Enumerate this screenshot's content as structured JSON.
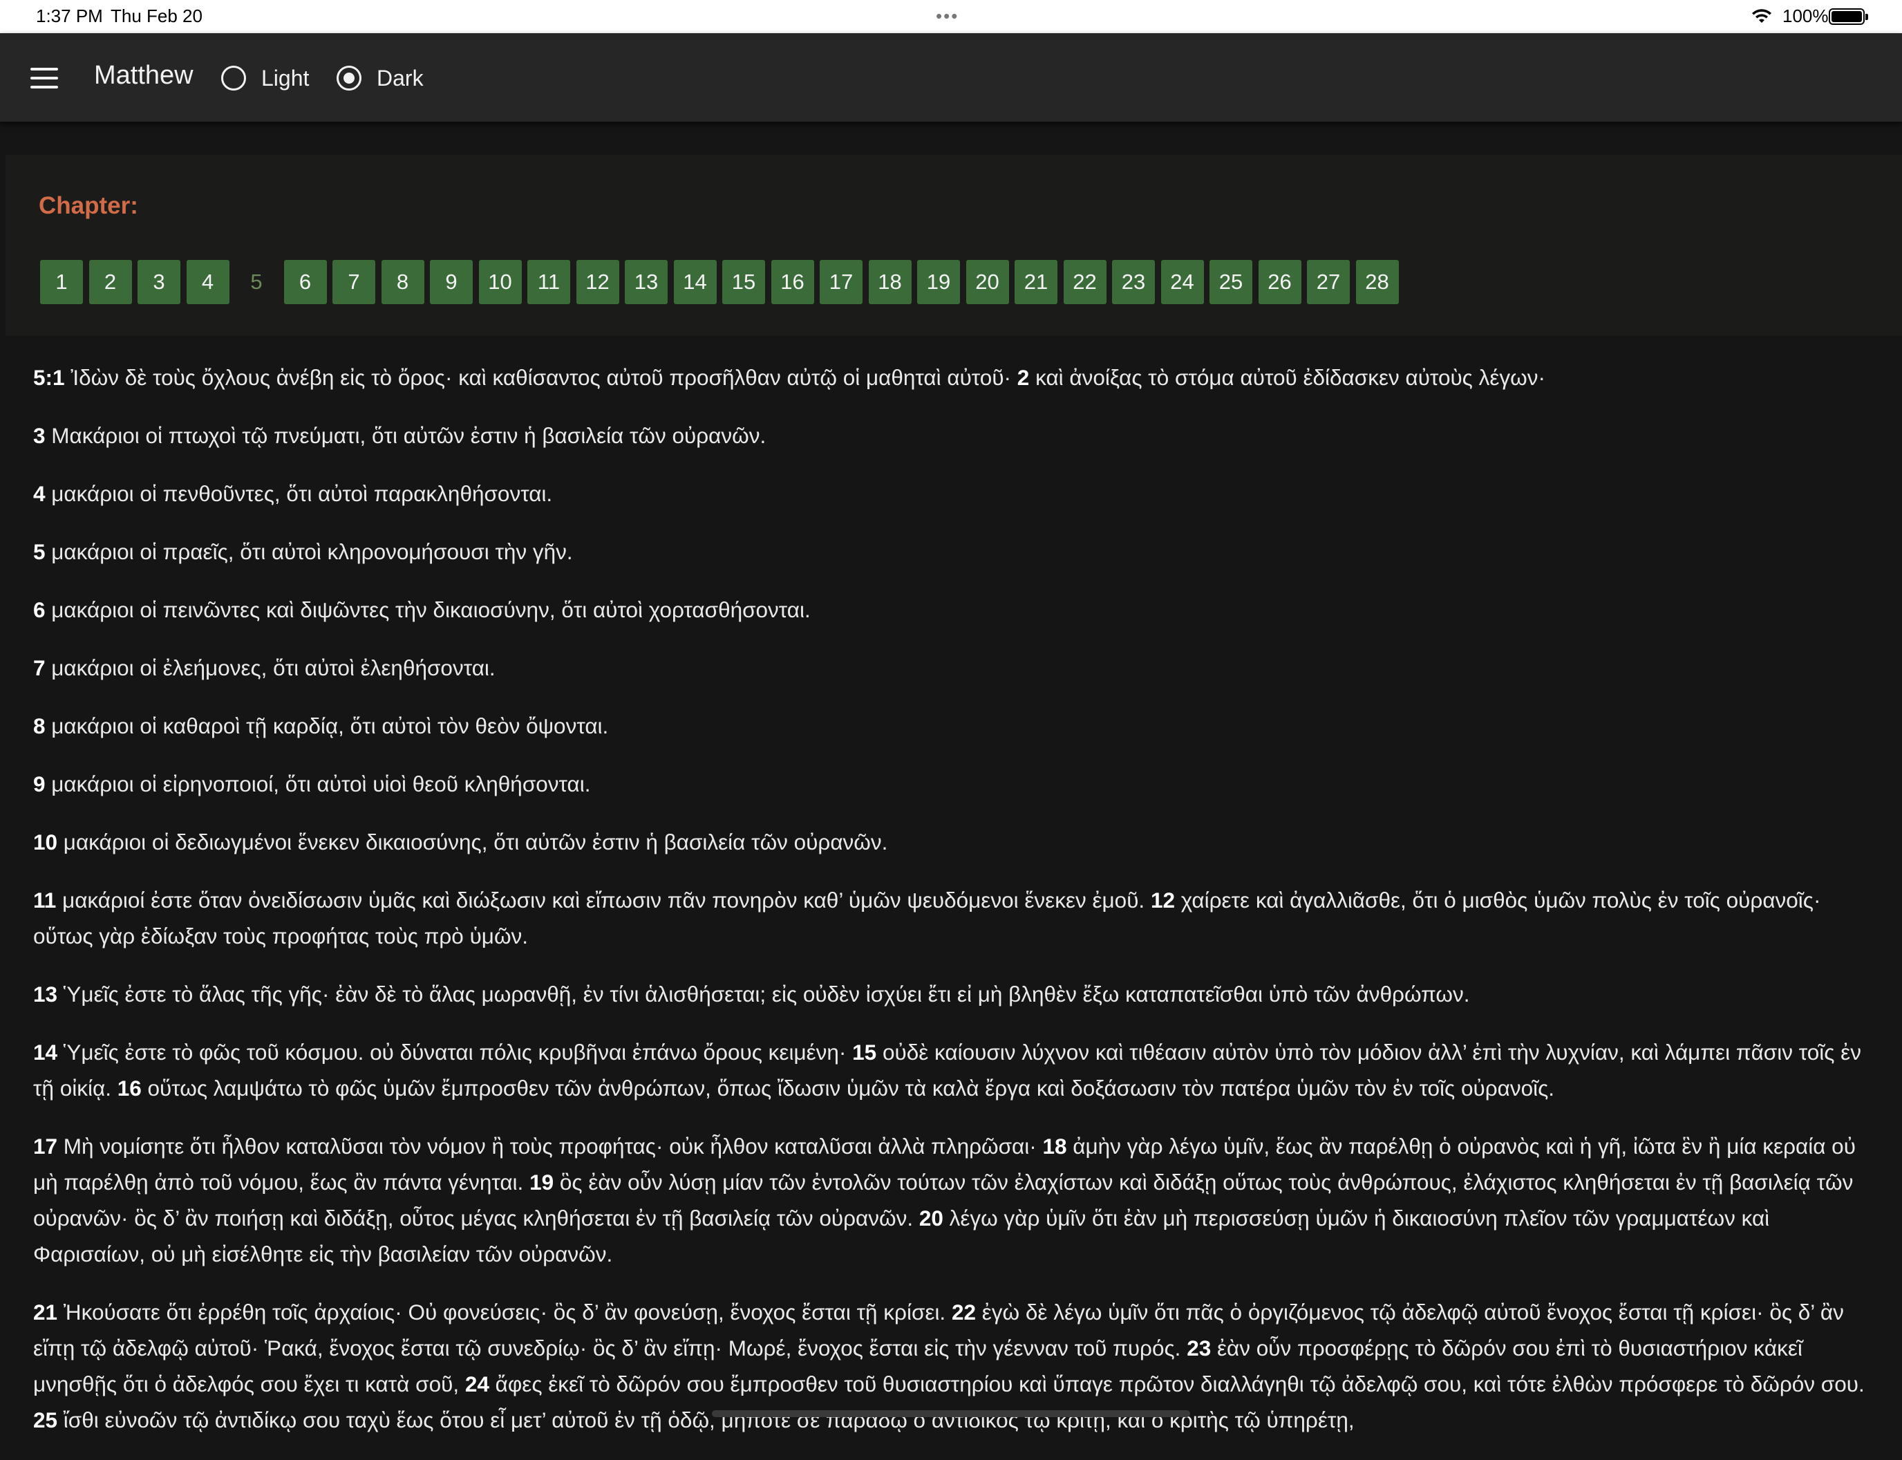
{
  "status_bar": {
    "time": "1:37 PM",
    "date": "Thu Feb 20",
    "dots": "•••",
    "battery": "100%"
  },
  "appbar": {
    "title": "Matthew",
    "theme_options": [
      {
        "label": "Light",
        "selected": false
      },
      {
        "label": "Dark",
        "selected": true
      }
    ]
  },
  "chapter_nav": {
    "label": "Chapter:",
    "current": "5",
    "chapters": [
      "1",
      "2",
      "3",
      "4",
      "5",
      "6",
      "7",
      "8",
      "9",
      "10",
      "11",
      "12",
      "13",
      "14",
      "15",
      "16",
      "17",
      "18",
      "19",
      "20",
      "21",
      "22",
      "23",
      "24",
      "25",
      "26",
      "27",
      "28"
    ]
  },
  "verses": [
    [
      {
        "n": "5:1",
        "t": " Ἰδὼν δὲ τοὺς ὄχλους ἀνέβη εἰς τὸ ὄρος· καὶ καθίσαντος αὐτοῦ προσῆλθαν αὐτῷ οἱ μαθηταὶ αὐτοῦ· "
      },
      {
        "n": "2",
        "t": " καὶ ἀνοίξας τὸ στόμα αὐτοῦ ἐδίδασκεν αὐτοὺς λέγων·"
      }
    ],
    [
      {
        "n": "3",
        "t": " Μακάριοι οἱ πτωχοὶ τῷ πνεύματι, ὅτι αὐτῶν ἐστιν ἡ βασιλεία τῶν οὐρανῶν."
      }
    ],
    [
      {
        "n": "4",
        "t": " μακάριοι οἱ πενθοῦντες, ὅτι αὐτοὶ παρακληθήσονται."
      }
    ],
    [
      {
        "n": "5",
        "t": " μακάριοι οἱ πραεῖς, ὅτι αὐτοὶ κληρονομήσουσι τὴν γῆν."
      }
    ],
    [
      {
        "n": "6",
        "t": " μακάριοι οἱ πεινῶντες καὶ διψῶντες τὴν δικαιοσύνην, ὅτι αὐτοὶ χορτασθήσονται."
      }
    ],
    [
      {
        "n": "7",
        "t": " μακάριοι οἱ ἐλεήμονες, ὅτι αὐτοὶ ἐλεηθήσονται."
      }
    ],
    [
      {
        "n": "8",
        "t": " μακάριοι οἱ καθαροὶ τῇ καρδίᾳ, ὅτι αὐτοὶ τὸν θεὸν ὄψονται."
      }
    ],
    [
      {
        "n": "9",
        "t": " μακάριοι οἱ εἰρηνοποιοί, ὅτι αὐτοὶ υἱοὶ θεοῦ κληθήσονται."
      }
    ],
    [
      {
        "n": "10",
        "t": " μακάριοι οἱ δεδιωγμένοι ἕνεκεν δικαιοσύνης, ὅτι αὐτῶν ἐστιν ἡ βασιλεία τῶν οὐρανῶν."
      }
    ],
    [
      {
        "n": "11",
        "t": " μακάριοί ἐστε ὅταν ὀνειδίσωσιν ὑμᾶς καὶ διώξωσιν καὶ εἴπωσιν πᾶν πονηρὸν καθ’ ὑμῶν ψευδόμενοι ἕνεκεν ἐμοῦ. "
      },
      {
        "n": "12",
        "t": " χαίρετε καὶ ἀγαλλιᾶσθε, ὅτι ὁ μισθὸς ὑμῶν πολὺς ἐν τοῖς οὐρανοῖς· οὕτως γὰρ ἐδίωξαν τοὺς προφήτας τοὺς πρὸ ὑμῶν."
      }
    ],
    [
      {
        "n": "13",
        "t": " Ὑμεῖς ἐστε τὸ ἅλας τῆς γῆς· ἐὰν δὲ τὸ ἅλας μωρανθῇ, ἐν τίνι ἁλισθήσεται; εἰς οὐδὲν ἰσχύει ἔτι εἰ μὴ βληθὲν ἔξω καταπατεῖσθαι ὑπὸ τῶν ἀνθρώπων."
      }
    ],
    [
      {
        "n": "14",
        "t": " Ὑμεῖς ἐστε τὸ φῶς τοῦ κόσμου. οὐ δύναται πόλις κρυβῆναι ἐπάνω ὄρους κειμένη· "
      },
      {
        "n": "15",
        "t": " οὐδὲ καίουσιν λύχνον καὶ τιθέασιν αὐτὸν ὑπὸ τὸν μόδιον ἀλλ’ ἐπὶ τὴν λυχνίαν, καὶ λάμπει πᾶσιν τοῖς ἐν τῇ οἰκίᾳ. "
      },
      {
        "n": "16",
        "t": " οὕτως λαμψάτω τὸ φῶς ὑμῶν ἔμπροσθεν τῶν ἀνθρώπων, ὅπως ἴδωσιν ὑμῶν τὰ καλὰ ἔργα καὶ δοξάσωσιν τὸν πατέρα ὑμῶν τὸν ἐν τοῖς οὐρανοῖς."
      }
    ],
    [
      {
        "n": "17",
        "t": " Μὴ νομίσητε ὅτι ἦλθον καταλῦσαι τὸν νόμον ἢ τοὺς προφήτας· οὐκ ἦλθον καταλῦσαι ἀλλὰ πληρῶσαι· "
      },
      {
        "n": "18",
        "t": " ἀμὴν γὰρ λέγω ὑμῖν, ἕως ἂν παρέλθῃ ὁ οὐρανὸς καὶ ἡ γῆ, ἰῶτα ἓν ἢ μία κεραία οὐ μὴ παρέλθῃ ἀπὸ τοῦ νόμου, ἕως ἂν πάντα γένηται. "
      },
      {
        "n": "19",
        "t": " ὃς ἐὰν οὖν λύσῃ μίαν τῶν ἐντολῶν τούτων τῶν ἐλαχίστων καὶ διδάξῃ οὕτως τοὺς ἀνθρώπους, ἐλάχιστος κληθήσεται ἐν τῇ βασιλείᾳ τῶν οὐρανῶν· ὃς δ’ ἂν ποιήσῃ καὶ διδάξῃ, οὗτος μέγας κληθήσεται ἐν τῇ βασιλείᾳ τῶν οὐρανῶν. "
      },
      {
        "n": "20",
        "t": " λέγω γὰρ ὑμῖν ὅτι ἐὰν μὴ περισσεύσῃ ὑμῶν ἡ δικαιοσύνη πλεῖον τῶν γραμματέων καὶ Φαρισαίων, οὐ μὴ εἰσέλθητε εἰς τὴν βασιλείαν τῶν οὐρανῶν."
      }
    ],
    [
      {
        "n": "21",
        "t": " Ἠκούσατε ὅτι ἐρρέθη τοῖς ἀρχαίοις· Οὐ φονεύσεις· ὃς δ’ ἂν φονεύσῃ, ἔνοχος ἔσται τῇ κρίσει. "
      },
      {
        "n": "22",
        "t": " ἐγὼ δὲ λέγω ὑμῖν ὅτι πᾶς ὁ ὀργιζόμενος τῷ ἀδελφῷ αὐτοῦ ἔνοχος ἔσται τῇ κρίσει· ὃς δ’ ἂν εἴπῃ τῷ ἀδελφῷ αὐτοῦ· Ῥακά, ἔνοχος ἔσται τῷ συνεδρίῳ· ὃς δ’ ἂν εἴπῃ· Μωρέ, ἔνοχος ἔσται εἰς τὴν γέενναν τοῦ πυρός. "
      },
      {
        "n": "23",
        "t": " ἐὰν οὖν προσφέρῃς τὸ δῶρόν σου ἐπὶ τὸ θυσιαστήριον κἀκεῖ μνησθῇς ὅτι ὁ ἀδελφός σου ἔχει τι κατὰ σοῦ, "
      },
      {
        "n": "24",
        "t": " ἄφες ἐκεῖ τὸ δῶρόν σου ἔμπροσθεν τοῦ θυσιαστηρίου καὶ ὕπαγε πρῶτον διαλλάγηθι τῷ ἀδελφῷ σου, καὶ τότε ἐλθὼν πρόσφερε τὸ δῶρόν σου. "
      },
      {
        "n": "25",
        "t": " ἴσθι εὐνοῶν τῷ ἀντιδίκῳ σου ταχὺ ἕως ὅτου εἶ μετ’ αὐτοῦ ἐν τῇ ὁδῷ, μήποτέ σε παραδῷ ὁ ἀντίδικος τῷ κριτῇ, καὶ ὁ κριτὴς τῷ ὑπηρέτῃ,"
      }
    ]
  ]
}
